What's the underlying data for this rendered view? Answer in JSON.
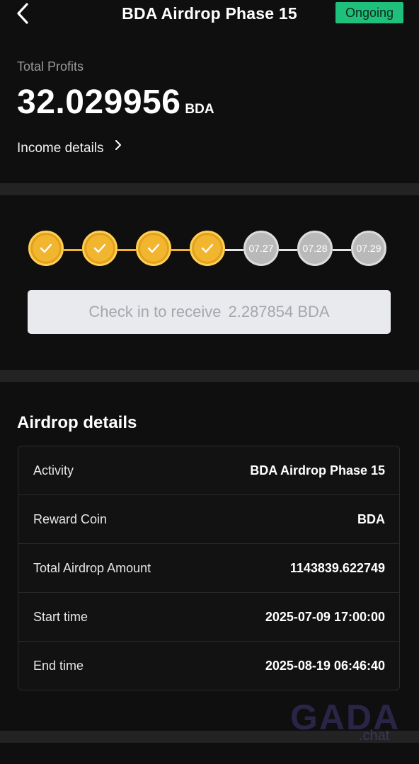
{
  "header": {
    "title": "BDA Airdrop Phase 15",
    "status": "Ongoing",
    "colors": {
      "status_bg": "#1fc07b",
      "background": "#0f0f0f"
    }
  },
  "profits": {
    "label": "Total Profits",
    "value": "32.029956",
    "unit": "BDA",
    "income_link": "Income details"
  },
  "checkin": {
    "days": [
      {
        "state": "done",
        "label": ""
      },
      {
        "state": "done",
        "label": ""
      },
      {
        "state": "done",
        "label": ""
      },
      {
        "state": "done",
        "label": ""
      },
      {
        "state": "pending",
        "label": "07.27"
      },
      {
        "state": "pending",
        "label": "07.28"
      },
      {
        "state": "pending",
        "label": "07.29"
      }
    ],
    "button_label": "Check in to receive",
    "button_amount": "2.287854 BDA",
    "colors": {
      "done": "#f2b52e",
      "pending": "#b9b9b9"
    }
  },
  "details": {
    "title": "Airdrop details",
    "rows": [
      {
        "key": "Activity",
        "value": "BDA Airdrop Phase 15"
      },
      {
        "key": "Reward Coin",
        "value": "BDA"
      },
      {
        "key": "Total Airdrop Amount",
        "value": "1143839.622749"
      },
      {
        "key": "Start time",
        "value": "2025-07-09 17:00:00"
      },
      {
        "key": "End time",
        "value": "2025-08-19 06:46:40"
      }
    ]
  },
  "watermark": {
    "text": "GADA",
    "sub": ".chat"
  }
}
